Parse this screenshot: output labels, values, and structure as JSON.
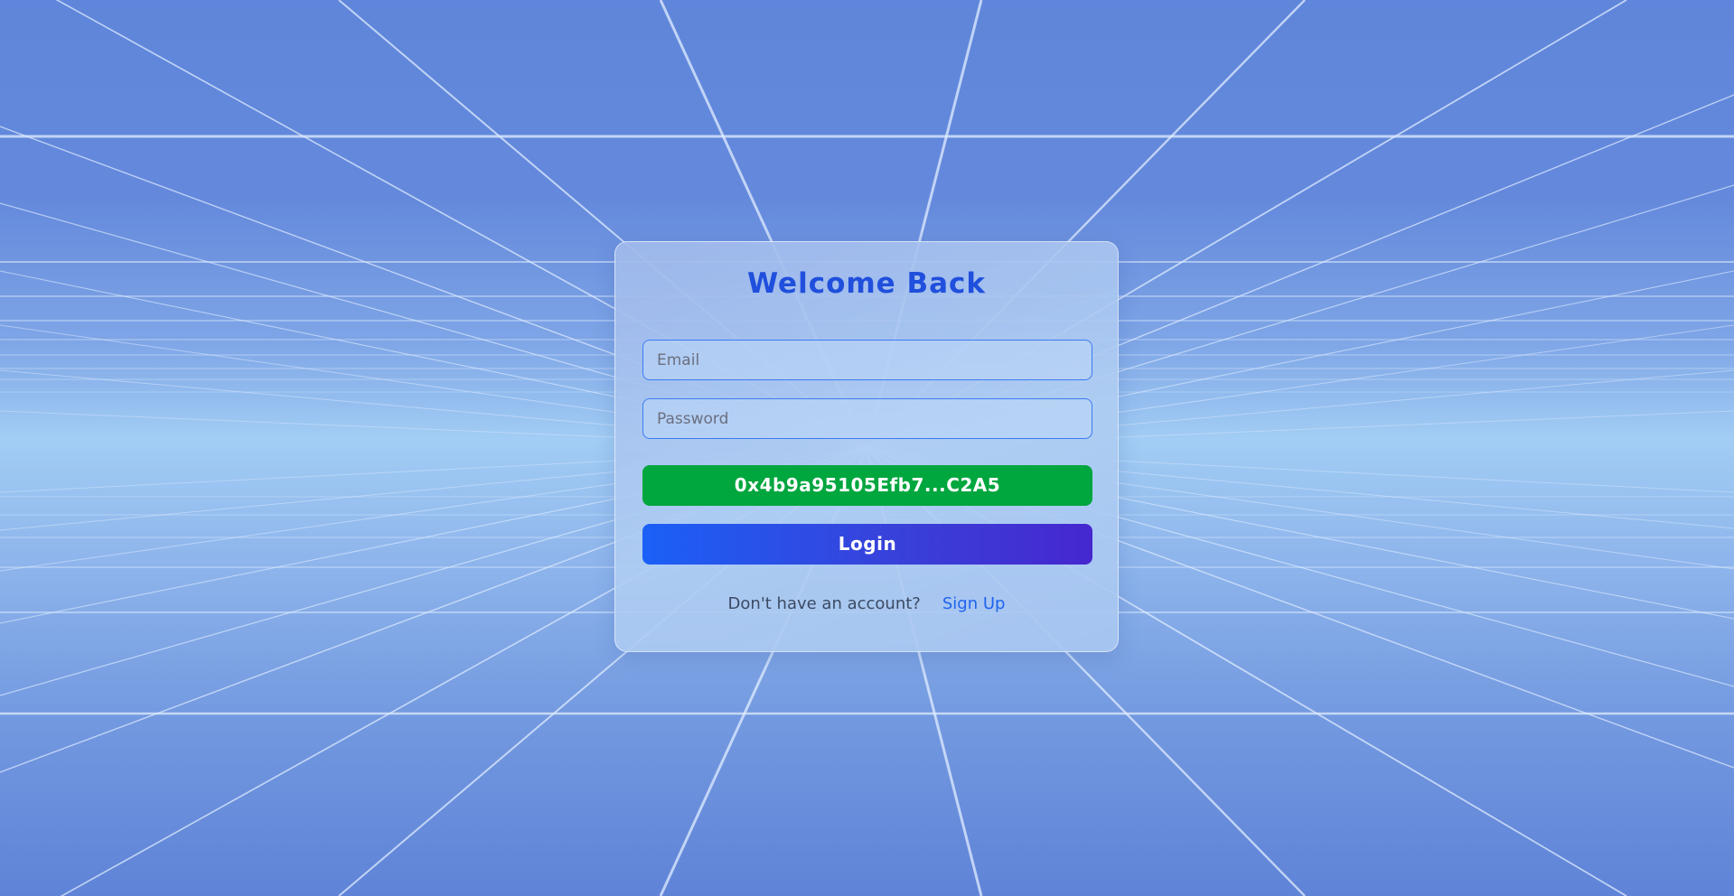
{
  "login_card": {
    "title": "Welcome Back",
    "email_placeholder": "Email",
    "password_placeholder": "Password",
    "wallet_address": "0x4b9a95105Efb7...C2A5",
    "login_label": "Login",
    "signup_prompt": "Don't have an account?",
    "signup_link": "Sign Up"
  },
  "colors": {
    "title": "#1f4fdc",
    "wallet_button": "#00a63e",
    "login_gradient_start": "#1b60f6",
    "login_gradient_end": "#4527cf",
    "link": "#1f63ef",
    "grid_lines": "#dbe9ff"
  }
}
